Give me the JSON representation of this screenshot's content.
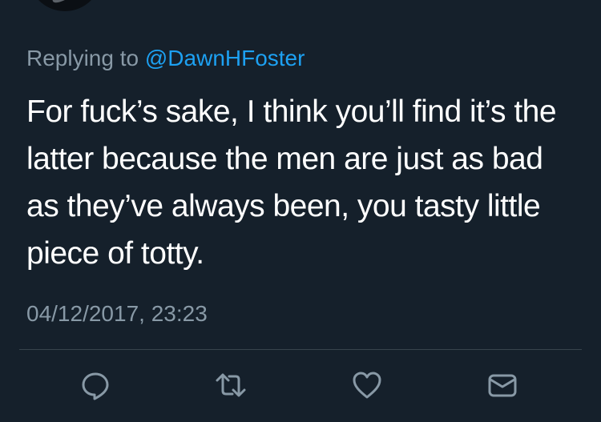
{
  "tweet": {
    "replying_prefix": "Replying to ",
    "reply_handle": "@DawnHFoster",
    "text": "For fuck’s sake, I think you’ll find it’s the latter because the men are just as bad as they’ve always been, you tasty little piece of totty.",
    "timestamp": "04/12/2017, 23:23"
  },
  "actions": {
    "icons": [
      "reply-icon",
      "retweet-icon",
      "like-icon",
      "share-message-icon"
    ]
  },
  "colors": {
    "background": "#15202b",
    "text": "#ffffff",
    "secondary_text": "#8899a6",
    "link": "#1da1f2",
    "divider": "#38444d"
  }
}
